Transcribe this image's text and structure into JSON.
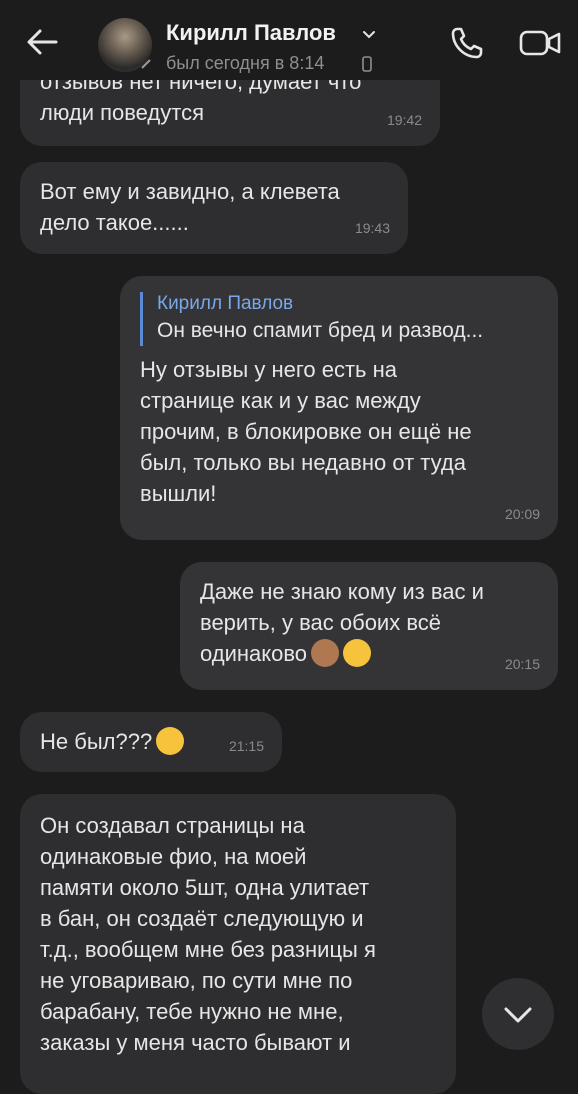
{
  "header": {
    "contact_name": "Кирилл Павлов",
    "status": "был сегодня в 8:14",
    "icons": [
      "back-arrow-icon",
      "chevron-down-icon",
      "mobile-phone-icon",
      "phone-call-icon",
      "video-call-icon"
    ]
  },
  "messages": [
    {
      "side": "in",
      "text": "отзывов нет ничего, думает что\nлюди поведутся",
      "time": "19:42"
    },
    {
      "side": "in",
      "text": "Вот ему и завидно, а клевета\nдело такое......",
      "time": "19:43"
    },
    {
      "side": "out",
      "reply_name": "Кирилл Павлов",
      "reply_text": "Он вечно спамит бред и развод...",
      "text": "Ну отзывы у него есть на\nстранице как и у вас между\nпрочим, в блокировке он ещё не\nбыл, только вы недавно от туда\nвышли!",
      "time": "20:09"
    },
    {
      "side": "out",
      "text": "Даже не знаю кому из вас и\nверить, у вас обоих всё\nодинаково",
      "emojis": [
        "see-no-evil-monkey-emoji",
        "thinking-face-emoji"
      ],
      "time": "20:15"
    },
    {
      "side": "in",
      "text": "Не был???",
      "emojis": [
        "grinning-face-emoji"
      ],
      "time": "21:15"
    },
    {
      "side": "in",
      "text": "Он создавал страницы на\nодинаковые фио, на моей\nпамяти около 5шт, одна улитает\nв бан, он создаёт следующую и\nт.д., вообщем мне без разницы я\nне уговариваю, по сути мне по\nбарабану, тебе нужно не мне,\nзаказы у меня часто бывают и"
    }
  ],
  "scroll_button": {
    "icon": "chevron-down-icon"
  }
}
